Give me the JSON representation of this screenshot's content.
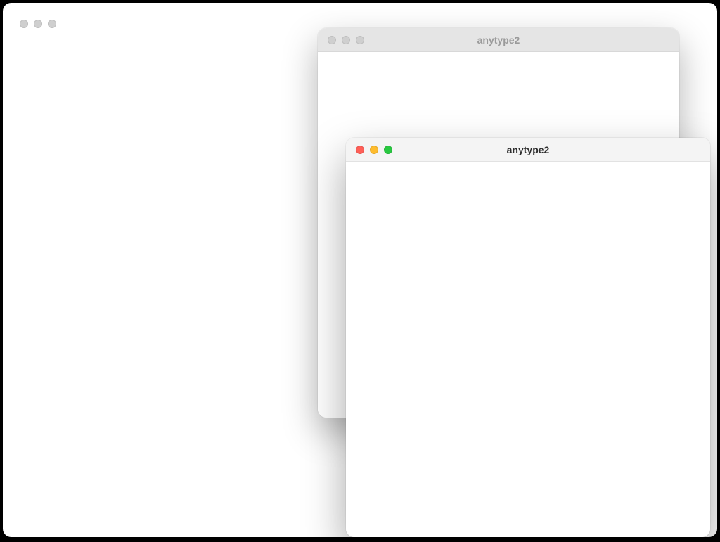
{
  "windows": {
    "main": {
      "title": ""
    },
    "secondary": {
      "title": "anytype2"
    },
    "front": {
      "title": "anytype2"
    }
  }
}
